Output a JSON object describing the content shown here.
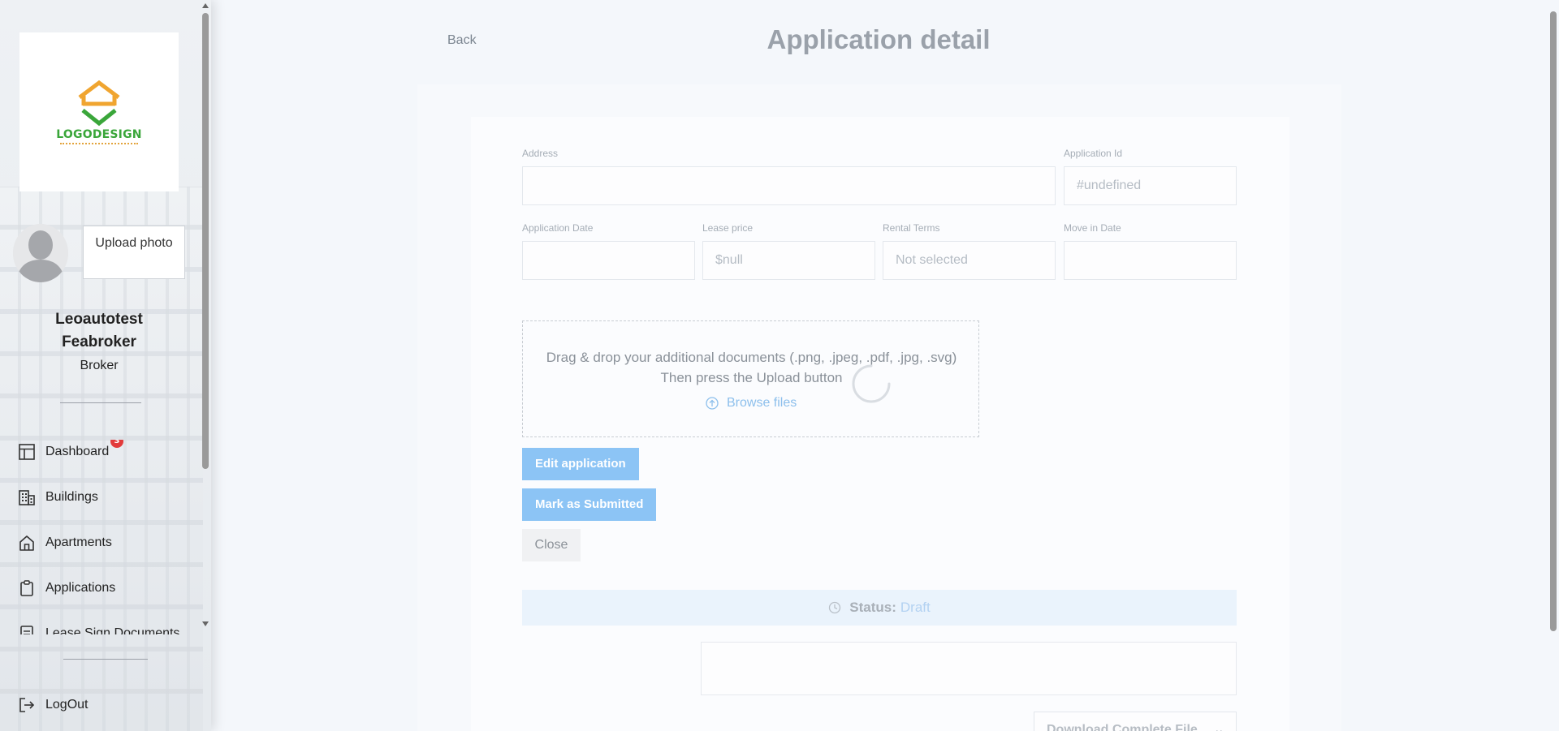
{
  "sidebar": {
    "logo": {
      "text": "LOGODESIGN",
      "slogan": "SLOGAN GOES HERE"
    },
    "upload_photo_label": "Upload photo",
    "user": {
      "name": "Leoautotest Feabroker",
      "role": "Broker"
    },
    "nav": [
      {
        "label": "Dashboard",
        "icon": "dashboard-icon",
        "badge": "3"
      },
      {
        "label": "Buildings",
        "icon": "buildings-icon"
      },
      {
        "label": "Apartments",
        "icon": "home-icon"
      },
      {
        "label": "Applications",
        "icon": "clipboard-icon"
      },
      {
        "label": "Lease Sign Documents",
        "icon": "document-icon"
      }
    ],
    "logout_label": "LogOut"
  },
  "header": {
    "back_label": "Back",
    "title": "Application detail"
  },
  "form": {
    "address": {
      "label": "Address",
      "value": ""
    },
    "application_id": {
      "label": "Application Id",
      "value": "#undefined"
    },
    "application_date": {
      "label": "Application Date",
      "value": ""
    },
    "lease_price": {
      "label": "Lease price",
      "value": "$null"
    },
    "rental_terms": {
      "label": "Rental Terms",
      "value": "Not selected"
    },
    "move_in_date": {
      "label": "Move in Date",
      "value": ""
    }
  },
  "dropzone": {
    "line1": "Drag & drop your additional documents (.png, .jpeg, .pdf, .jpg, .svg)",
    "line2": "Then press the Upload button",
    "browse_label": "Browse files"
  },
  "actions": {
    "edit_label": "Edit application",
    "submit_label": "Mark as Submitted",
    "close_label": "Close"
  },
  "status": {
    "label": "Status:",
    "value": "Draft"
  },
  "download_label": "Download Complete File",
  "colors": {
    "accent": "#8cc4f5",
    "badge": "#e23b3b",
    "logo_green": "#3aa63a",
    "logo_orange": "#f0a530"
  }
}
